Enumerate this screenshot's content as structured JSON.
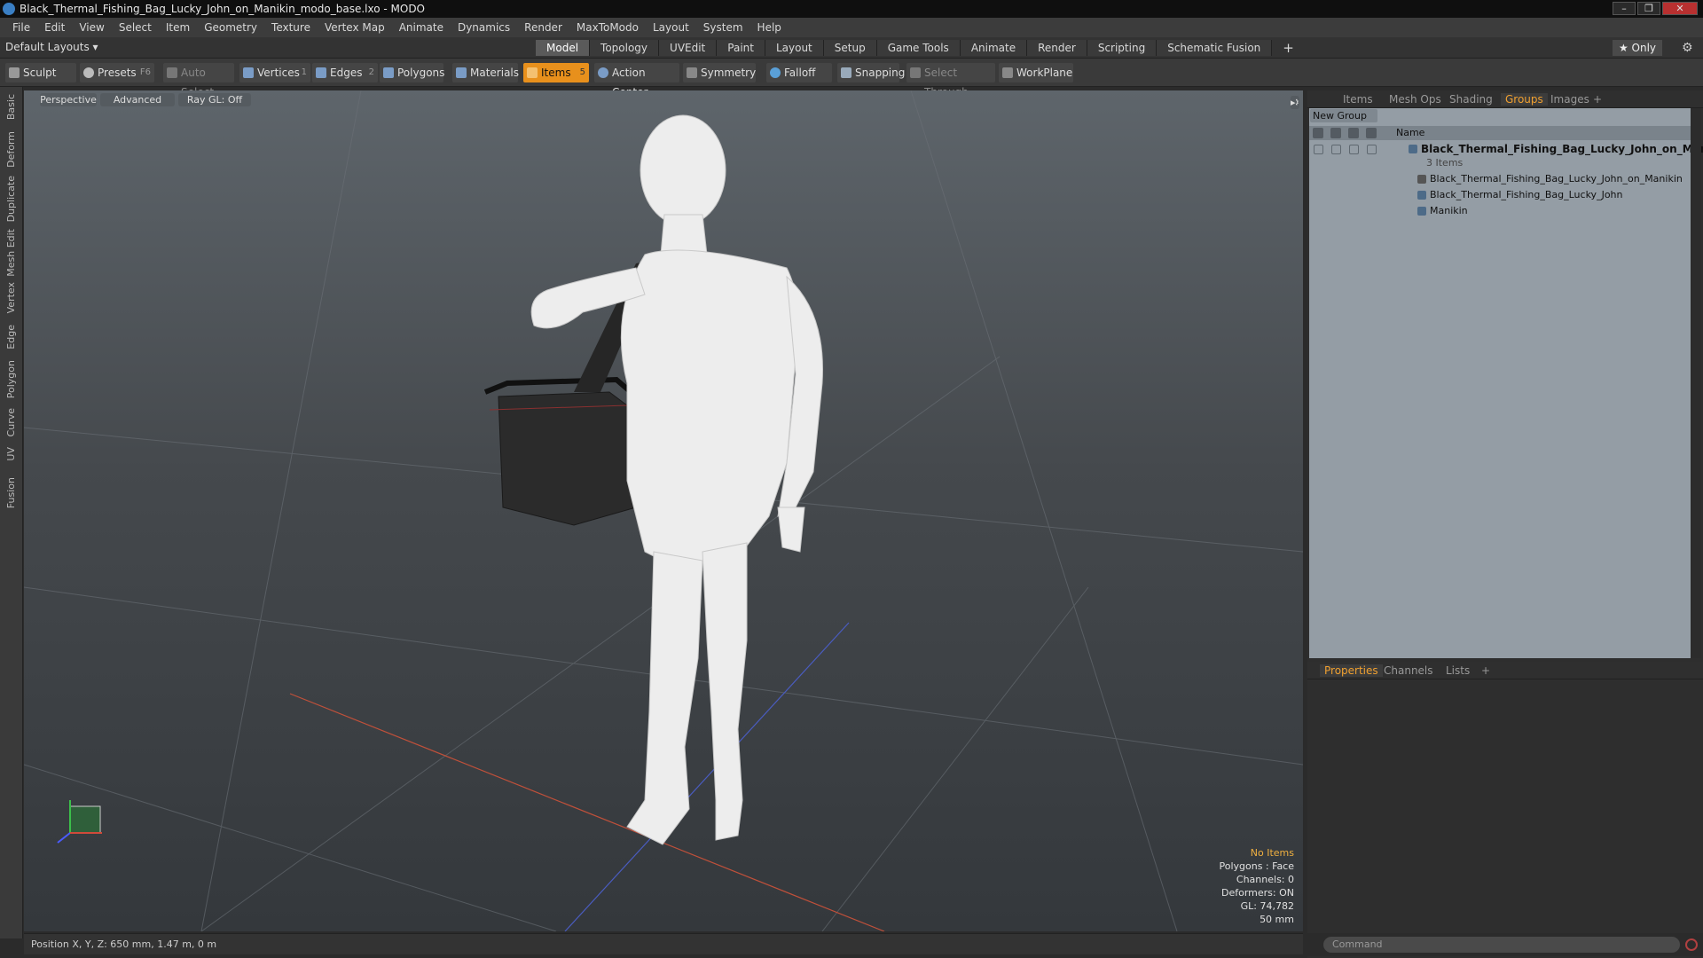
{
  "window": {
    "title": "Black_Thermal_Fishing_Bag_Lucky_John_on_Manikin_modo_base.lxo - MODO"
  },
  "menu": [
    "File",
    "Edit",
    "View",
    "Select",
    "Item",
    "Geometry",
    "Texture",
    "Vertex Map",
    "Animate",
    "Dynamics",
    "Render",
    "MaxToModo",
    "Layout",
    "System",
    "Help"
  ],
  "layoutbar": {
    "layouts_label": "Default Layouts ▾",
    "tabs": [
      "Model",
      "Topology",
      "UVEdit",
      "Paint",
      "Layout",
      "Setup",
      "Game Tools",
      "Animate",
      "Render",
      "Scripting",
      "Schematic Fusion"
    ],
    "active_tab": "Model",
    "only_label": "★ Only"
  },
  "toolbar": {
    "sculpt": "Sculpt",
    "presets": "Presets",
    "presets_key": "F6",
    "auto_select": "Auto Select",
    "vertices": "Vertices",
    "vertices_count": "1",
    "edges": "Edges",
    "edges_count": "2",
    "polygons": "Polygons",
    "materials": "Materials",
    "items": "Items",
    "items_count": "5",
    "action_center": "Action Center",
    "symmetry": "Symmetry",
    "falloff": "Falloff",
    "snapping": "Snapping",
    "select_through": "Select Through",
    "workplane": "WorkPlane"
  },
  "lefttabs": [
    "Basic",
    "Deform",
    "Duplicate",
    "Mesh Edit",
    "Vertex",
    "Edge",
    "Polygon",
    "Curve",
    "UV",
    "Fusion"
  ],
  "viewport": {
    "view": "Perspective",
    "shading": "Advanced",
    "raygl": "Ray GL: Off",
    "stats": {
      "selection": "No Items",
      "polygons": "Polygons : Face",
      "channels": "Channels: 0",
      "deformers": "Deformers: ON",
      "gl": "GL: 74,782",
      "scale": "50 mm"
    }
  },
  "status": {
    "position": "Position X, Y, Z:  650 mm, 1.47 m, 0 m"
  },
  "right_panel": {
    "tabs": [
      "Items",
      "Mesh Ops",
      "Shading",
      "Groups",
      "Images",
      "+"
    ],
    "active_tab": "Groups",
    "new_group": "New Group",
    "column_name": "Name",
    "group": {
      "name": "Black_Thermal_Fishing_Bag_Lucky_John_on_Mani...",
      "count": "3 Items"
    },
    "children": [
      "Black_Thermal_Fishing_Bag_Lucky_John_on_Manikin",
      "Black_Thermal_Fishing_Bag_Lucky_John",
      "Manikin"
    ],
    "props_tabs": [
      "Properties",
      "Channels",
      "Lists",
      "+"
    ],
    "props_active": "Properties",
    "command_placeholder": "Command"
  }
}
